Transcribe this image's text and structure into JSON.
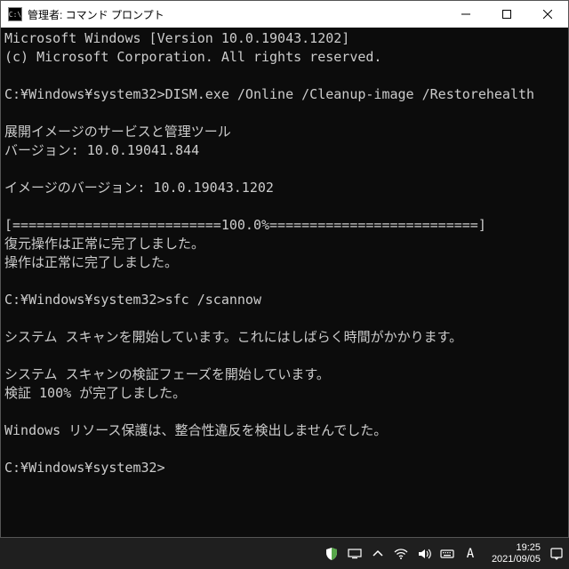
{
  "window": {
    "appicon_label": "C:\\",
    "title": "管理者: コマンド プロンプト"
  },
  "console": {
    "lines": [
      "Microsoft Windows [Version 10.0.19043.1202]",
      "(c) Microsoft Corporation. All rights reserved.",
      "",
      "C:¥Windows¥system32>DISM.exe /Online /Cleanup-image /Restorehealth",
      "",
      "展開イメージのサービスと管理ツール",
      "バージョン: 10.0.19041.844",
      "",
      "イメージのバージョン: 10.0.19043.1202",
      "",
      "[==========================100.0%==========================]",
      "復元操作は正常に完了しました。",
      "操作は正常に完了しました。",
      "",
      "C:¥Windows¥system32>sfc /scannow",
      "",
      "システム スキャンを開始しています。これにはしばらく時間がかかります。",
      "",
      "システム スキャンの検証フェーズを開始しています。",
      "検証 100% が完了しました。",
      "",
      "Windows リソース保護は、整合性違反を検出しませんでした。",
      "",
      "C:¥Windows¥system32>"
    ]
  },
  "tray": {
    "ime_mode": "A",
    "time": "19:25",
    "date": "2021/09/05"
  }
}
